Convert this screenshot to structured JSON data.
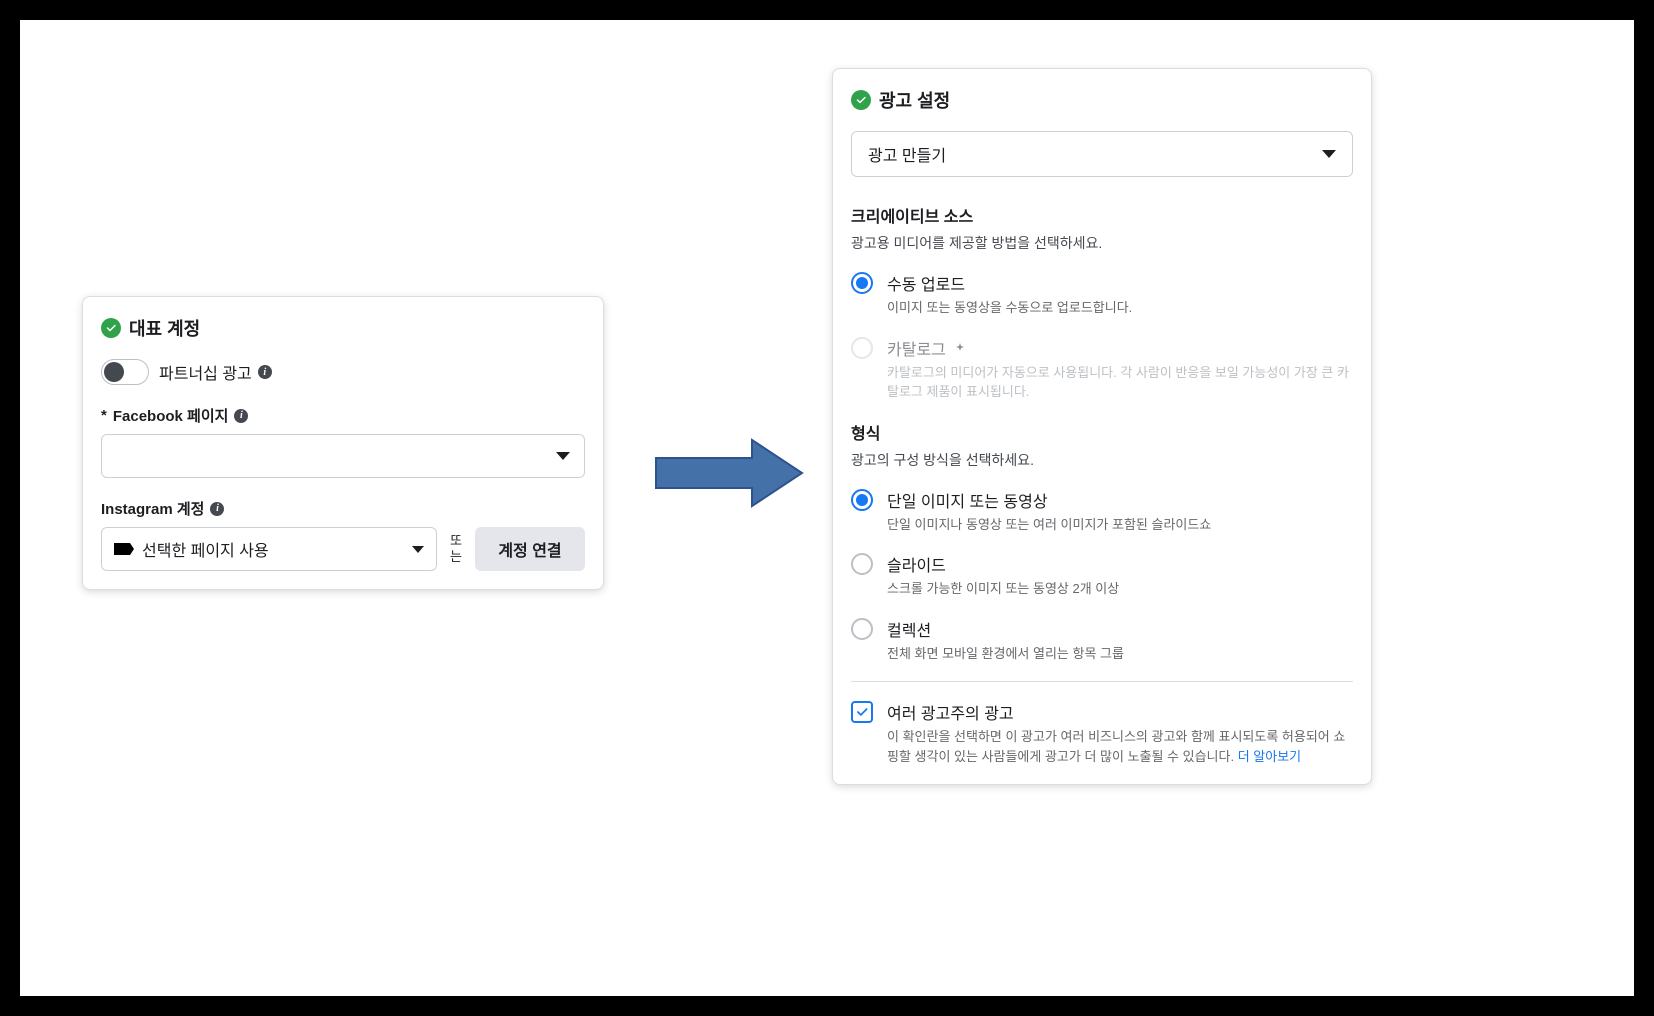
{
  "left": {
    "title": "대표 계정",
    "partnership": {
      "label": "파트너십 광고",
      "enabled": false
    },
    "facebook_page": {
      "label": "Facebook 페이지",
      "required_mark": "*",
      "value": ""
    },
    "instagram": {
      "label": "Instagram 계정",
      "selected": "선택한 페이지 사용",
      "or_text": "또는",
      "connect_button": "계정 연결"
    }
  },
  "right": {
    "title": "광고 설정",
    "dropdown": "광고 만들기",
    "creative_source": {
      "heading": "크리에이티브 소스",
      "sub": "광고용 미디어를 제공할 방법을 선택하세요.",
      "options": [
        {
          "title": "수동 업로드",
          "desc": "이미지 또는 동영상을 수동으로 업로드합니다.",
          "selected": true,
          "disabled": false
        },
        {
          "title": "카탈로그",
          "desc": "카탈로그의 미디어가 자동으로 사용됩니다. 각 사람이 반응을 보일 가능성이 가장 큰 카탈로그 제품이 표시됩니다.",
          "selected": false,
          "disabled": true
        }
      ]
    },
    "format": {
      "heading": "형식",
      "sub": "광고의 구성 방식을 선택하세요.",
      "options": [
        {
          "title": "단일 이미지 또는 동영상",
          "desc": "단일 이미지나 동영상 또는 여러 이미지가 포함된 슬라이드쇼",
          "selected": true
        },
        {
          "title": "슬라이드",
          "desc": "스크롤 가능한 이미지 또는 동영상 2개 이상",
          "selected": false
        },
        {
          "title": "컬렉션",
          "desc": "전체 화면 모바일 환경에서 열리는 항목 그룹",
          "selected": false
        }
      ]
    },
    "multi_advertiser": {
      "title": "여러 광고주의 광고",
      "desc": "이 확인란을 선택하면 이 광고가 여러 비즈니스의 광고와 함께 표시되도록 허용되어 쇼핑할 생각이 있는 사람들에게 광고가 더 많이 노출될 수 있습니다.",
      "learn_more": "더 알아보기",
      "checked": true
    }
  }
}
